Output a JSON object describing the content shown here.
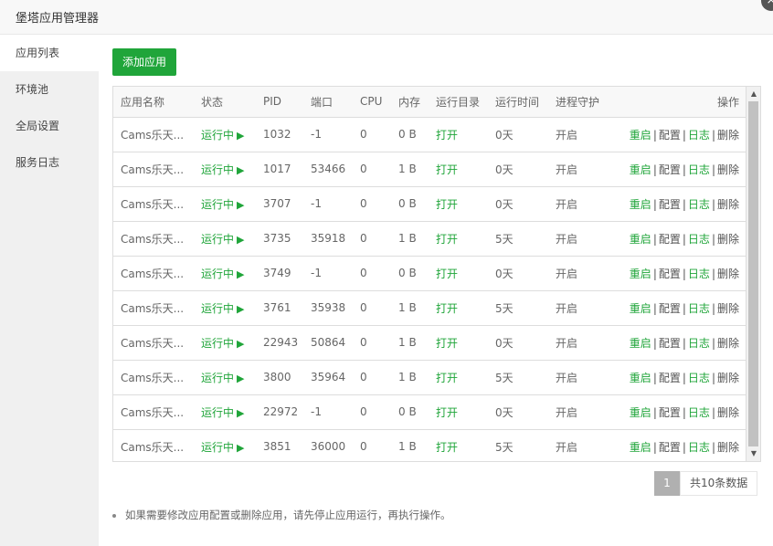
{
  "window": {
    "title": "堡塔应用管理器"
  },
  "sidebar": {
    "items": [
      {
        "label": "应用列表"
      },
      {
        "label": "环境池"
      },
      {
        "label": "全局设置"
      },
      {
        "label": "服务日志"
      }
    ]
  },
  "toolbar": {
    "add_label": "添加应用"
  },
  "table": {
    "headers": {
      "name": "应用名称",
      "status": "状态",
      "pid": "PID",
      "port": "端口",
      "cpu": "CPU",
      "mem": "内存",
      "dir": "运行目录",
      "time": "运行时间",
      "guard": "进程守护",
      "ops": "操作"
    },
    "rows": [
      {
        "name": "Cams乐天...",
        "status": "运行中",
        "pid": "1032",
        "port": "-1",
        "cpu": "0",
        "mem": "0 B",
        "dir": "打开",
        "time": "0天",
        "guard": "开启"
      },
      {
        "name": "Cams乐天...",
        "status": "运行中",
        "pid": "1017",
        "port": "53466",
        "cpu": "0",
        "mem": "1 B",
        "dir": "打开",
        "time": "0天",
        "guard": "开启"
      },
      {
        "name": "Cams乐天...",
        "status": "运行中",
        "pid": "3707",
        "port": "-1",
        "cpu": "0",
        "mem": "0 B",
        "dir": "打开",
        "time": "0天",
        "guard": "开启"
      },
      {
        "name": "Cams乐天...",
        "status": "运行中",
        "pid": "3735",
        "port": "35918",
        "cpu": "0",
        "mem": "1 B",
        "dir": "打开",
        "time": "5天",
        "guard": "开启"
      },
      {
        "name": "Cams乐天...",
        "status": "运行中",
        "pid": "3749",
        "port": "-1",
        "cpu": "0",
        "mem": "0 B",
        "dir": "打开",
        "time": "0天",
        "guard": "开启"
      },
      {
        "name": "Cams乐天...",
        "status": "运行中",
        "pid": "3761",
        "port": "35938",
        "cpu": "0",
        "mem": "1 B",
        "dir": "打开",
        "time": "5天",
        "guard": "开启"
      },
      {
        "name": "Cams乐天...",
        "status": "运行中",
        "pid": "22943",
        "port": "50864",
        "cpu": "0",
        "mem": "1 B",
        "dir": "打开",
        "time": "0天",
        "guard": "开启"
      },
      {
        "name": "Cams乐天...",
        "status": "运行中",
        "pid": "3800",
        "port": "35964",
        "cpu": "0",
        "mem": "1 B",
        "dir": "打开",
        "time": "5天",
        "guard": "开启"
      },
      {
        "name": "Cams乐天...",
        "status": "运行中",
        "pid": "22972",
        "port": "-1",
        "cpu": "0",
        "mem": "0 B",
        "dir": "打开",
        "time": "0天",
        "guard": "开启"
      },
      {
        "name": "Cams乐天...",
        "status": "运行中",
        "pid": "3851",
        "port": "36000",
        "cpu": "0",
        "mem": "1 B",
        "dir": "打开",
        "time": "5天",
        "guard": "开启"
      }
    ],
    "actions": {
      "restart": "重启",
      "config": "配置",
      "log": "日志",
      "delete": "删除",
      "separator": "|"
    }
  },
  "pagination": {
    "current": "1",
    "total_text": "共10条数据"
  },
  "tip": "如果需要修改应用配置或删除应用，请先停止应用运行，再执行操作。",
  "icons": {
    "run": "play-icon",
    "close": "close-icon"
  },
  "colors": {
    "accent": "#20a53a",
    "page_num_bg": "#b0b0b0"
  }
}
